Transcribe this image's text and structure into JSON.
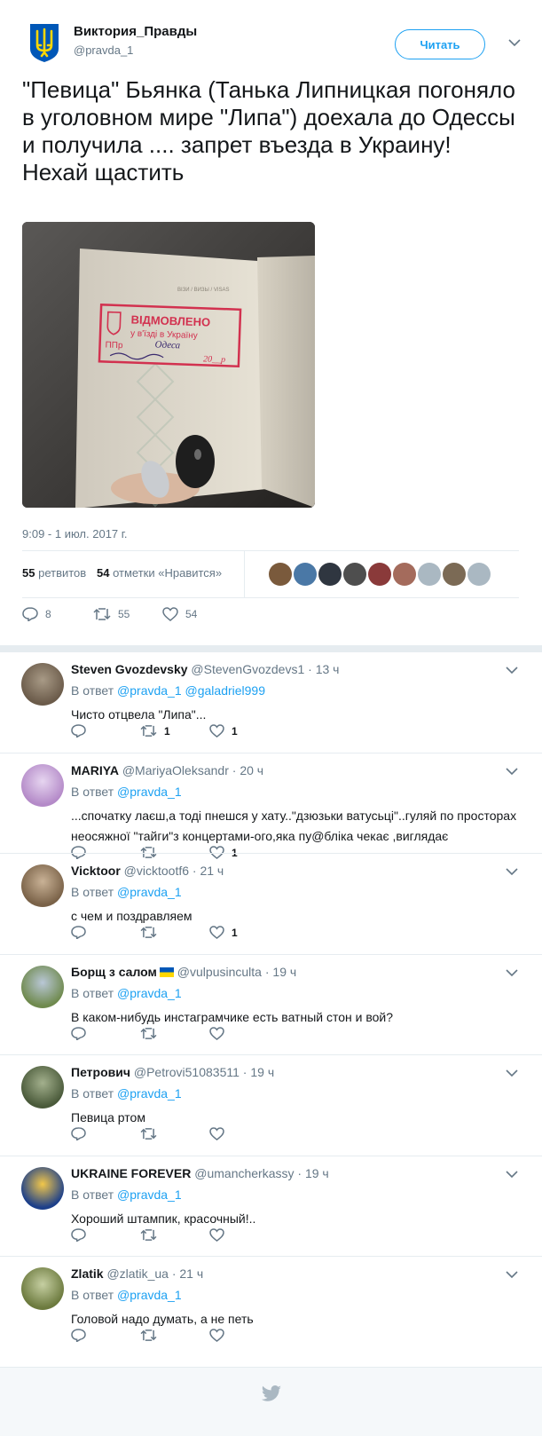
{
  "tweet": {
    "author_name": "Виктория_Правды",
    "author_handle": "@pravda_1",
    "follow_label": "Читать",
    "text": "\"Певица\" Бьянка (Танька Липницкая погоняло в уголовном мире \"Липа\") доехала до Одессы и получила .... запрет въезда в Украину!\nНехай щастить",
    "image_stamp": {
      "line1": "ВІДМОВЛЕНО",
      "line2": "у в'їзді в Україну",
      "line3": "ППр",
      "handwritten": "Одеса",
      "date": "20__р",
      "page_header": "ВІЗИ / ВИЗЫ / VISAS"
    },
    "timestamp": "9:09 - 1 июл. 2017 г.",
    "retweets_count": "55",
    "retweets_label": "ретвитов",
    "likes_count": "54",
    "likes_label": "отметки «Нравится»",
    "actions": {
      "reply_count": "8",
      "retweet_count": "55",
      "like_count": "54"
    }
  },
  "replies": [
    {
      "name": "Steven Gvozdevsky",
      "handle": "@StevenGvozdevs1",
      "time": "13 ч",
      "reply_prefix": "В ответ",
      "reply_to": "@pravda_1 @galadriel999",
      "text": "Чисто отцвела \"Липа\"...",
      "retweets": "1",
      "likes": "1",
      "colors": [
        "#6b5b4a",
        "#a89a86"
      ]
    },
    {
      "name": "MARIYA",
      "handle": "@MariyaOleksandr",
      "time": "20 ч",
      "reply_prefix": "В ответ",
      "reply_to": "@pravda_1",
      "text": "...спочатку лаєш,а тоді пнешся у хату..\"дзюзьки ватусьці\"..гуляй по просторах неосяжної \"тайги\"з концертами-ого,яка пу@бліка чекає ,виглядає",
      "retweets": "",
      "likes": "1",
      "colors": [
        "#b48ac8",
        "#e6d5f0"
      ]
    },
    {
      "name": "Vicktoor",
      "handle": "@vicktootf6",
      "time": "21 ч",
      "reply_prefix": "В ответ",
      "reply_to": "@pravda_1",
      "text": "с чем и поздравляем",
      "retweets": "",
      "likes": "1",
      "colors": [
        "#7a6248",
        "#c9b296"
      ]
    },
    {
      "name": "Борщ з салом",
      "handle": "@vulpusinculta",
      "time": "19 ч",
      "reply_prefix": "В ответ",
      "reply_to": "@pravda_1",
      "text": "В каком-нибудь инстаграмчике есть ватный стон и вой?",
      "retweets": "",
      "likes": "",
      "colors": [
        "#6f8a4e",
        "#b9c7d6"
      ]
    },
    {
      "name": "Петрович",
      "handle": "@Petrovi51083511",
      "time": "19 ч",
      "reply_prefix": "В ответ",
      "reply_to": "@pravda_1",
      "text": "Певица ртом",
      "retweets": "",
      "likes": "",
      "colors": [
        "#4a5a3a",
        "#a3b08d"
      ]
    },
    {
      "name": "UKRAINE FOREVER",
      "handle": "@umancherkassy",
      "time": "19 ч",
      "reply_prefix": "В ответ",
      "reply_to": "@pravda_1",
      "text": "Хороший штампик, красочный!..",
      "retweets": "",
      "likes": "",
      "colors": [
        "#1c3f8a",
        "#f2c74a"
      ]
    },
    {
      "name": "Zlatik",
      "handle": "@zlatik_ua",
      "time": "21 ч",
      "reply_prefix": "В ответ",
      "reply_to": "@pravda_1",
      "text": "Головой надо думать, а не петь",
      "retweets": "",
      "likes": "",
      "colors": [
        "#6c7a3e",
        "#c6cfa2"
      ]
    }
  ],
  "colors": {
    "accent": "#1da1f2",
    "muted": "#657786",
    "text": "#14171a",
    "border": "#e6ecf0"
  },
  "icons": [
    "trident-icon",
    "chevron-down-icon",
    "reply-icon",
    "retweet-icon",
    "like-icon",
    "twitter-bird-icon",
    "ukraine-flag-icon"
  ]
}
